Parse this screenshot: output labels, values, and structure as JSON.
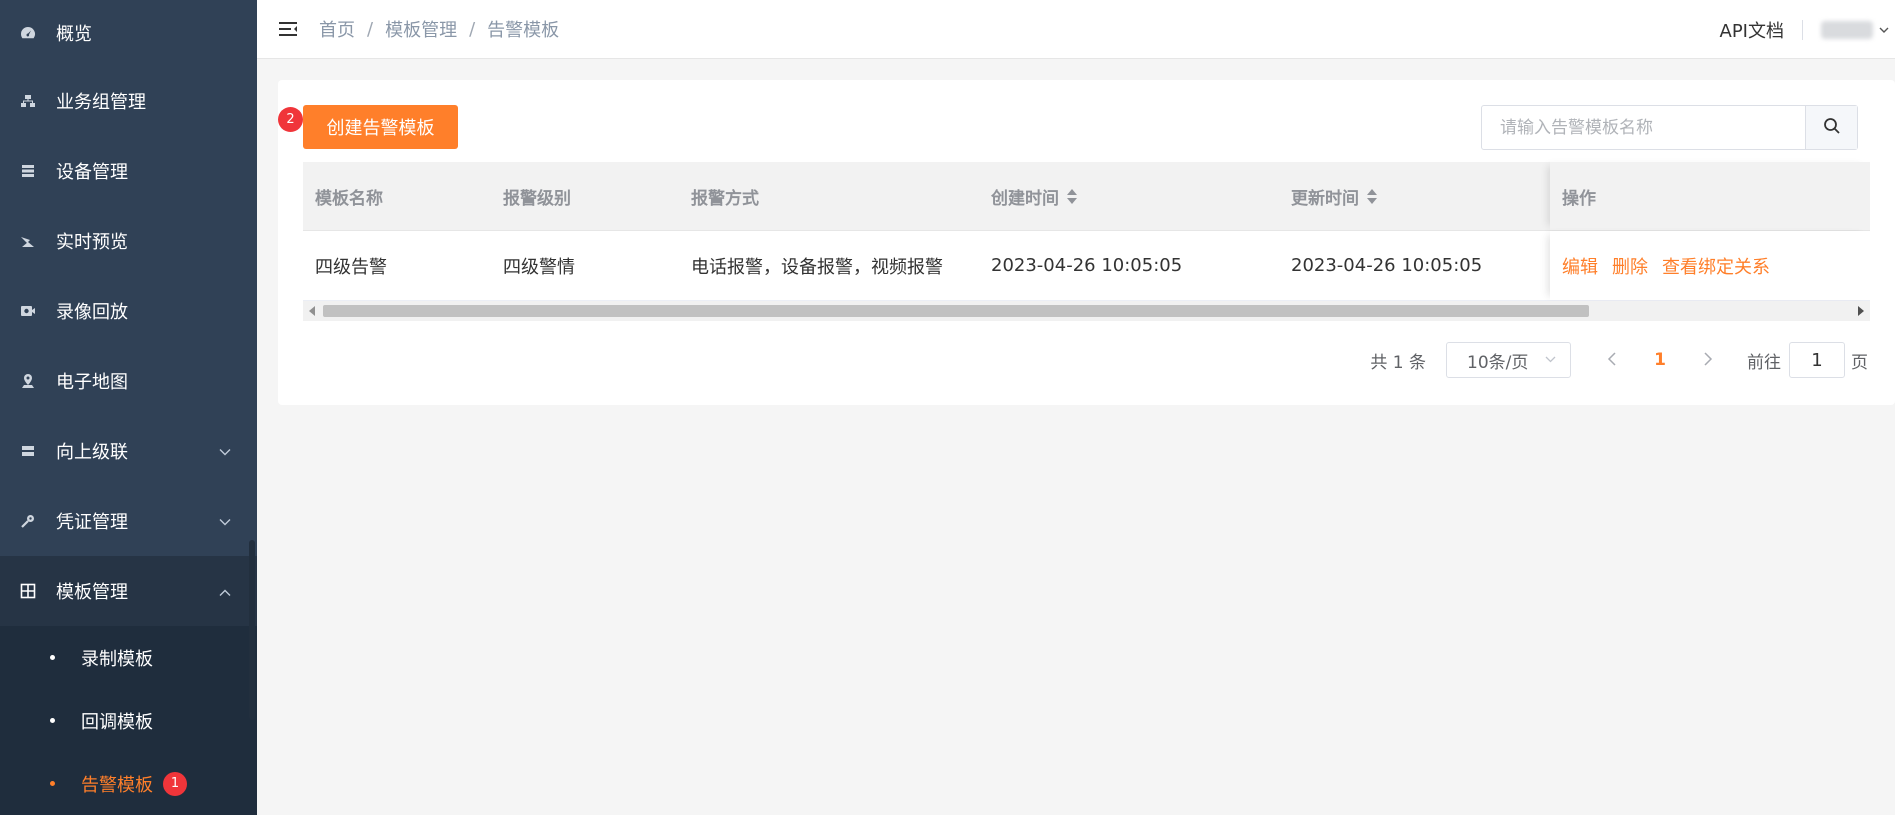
{
  "sidebar": {
    "items": [
      {
        "label": "概览",
        "icon": "dashboard-icon"
      },
      {
        "label": "业务组管理",
        "icon": "org-tree-icon"
      },
      {
        "label": "设备管理",
        "icon": "server-icon"
      },
      {
        "label": "实时预览",
        "icon": "video-preview-icon"
      },
      {
        "label": "录像回放",
        "icon": "camera-playback-icon"
      },
      {
        "label": "电子地图",
        "icon": "map-pin-icon"
      },
      {
        "label": "向上级联",
        "icon": "cascade-icon"
      },
      {
        "label": "凭证管理",
        "icon": "key-icon"
      },
      {
        "label": "模板管理",
        "icon": "grid-icon"
      }
    ],
    "submenu": [
      {
        "label": "录制模板"
      },
      {
        "label": "回调模板"
      },
      {
        "label": "告警模板",
        "badge": "1"
      }
    ]
  },
  "header": {
    "breadcrumb": [
      "首页",
      "模板管理",
      "告警模板"
    ],
    "api_doc": "API文档"
  },
  "toolbar": {
    "create_label": "创建告警模板",
    "create_badge": "2",
    "search_placeholder": "请输入告警模板名称"
  },
  "table": {
    "headers": [
      "模板名称",
      "报警级别",
      "报警方式",
      "创建时间",
      "更新时间",
      "操作"
    ],
    "rows": [
      {
        "name": "四级告警",
        "level": "四级警情",
        "method": "电话报警，设备报警，视频报警",
        "created": "2023-04-26 10:05:05",
        "updated": "2023-04-26 10:05:05",
        "actions": [
          "编辑",
          "删除",
          "查看绑定关系"
        ]
      }
    ]
  },
  "pagination": {
    "total": "共 1 条",
    "page_size": "10条/页",
    "current": "1",
    "goto_label": "前往",
    "goto_value": "1",
    "page_suffix": "页"
  },
  "colors": {
    "accent": "#ff7f2a",
    "sidebar_bg": "#304156",
    "badge": "#f0353a"
  }
}
